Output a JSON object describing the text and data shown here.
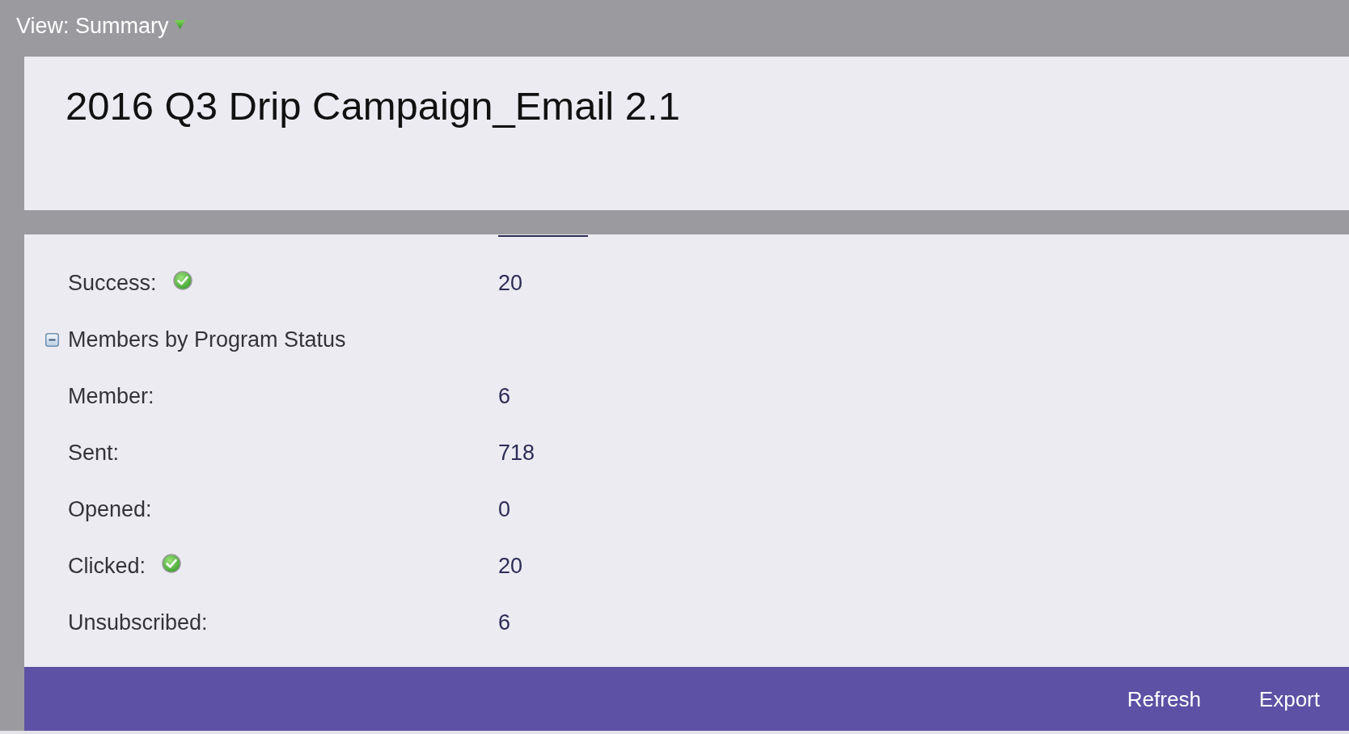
{
  "view_selector": {
    "label": "View: Summary"
  },
  "title": "2016 Q3 Drip Campaign_Email 2.1",
  "rows": [
    {
      "kind": "stat",
      "label": "Success:",
      "value": "20",
      "checked": true
    },
    {
      "kind": "group",
      "label": "Members by Program Status",
      "expanded": true
    },
    {
      "kind": "stat",
      "label": "Member:",
      "value": "6",
      "checked": false
    },
    {
      "kind": "stat",
      "label": "Sent:",
      "value": "718",
      "checked": false
    },
    {
      "kind": "stat",
      "label": "Opened:",
      "value": "0",
      "checked": false
    },
    {
      "kind": "stat",
      "label": "Clicked:",
      "value": "20",
      "checked": true
    },
    {
      "kind": "stat",
      "label": "Unsubscribed:",
      "value": "6",
      "checked": false
    }
  ],
  "footer": {
    "buttons": [
      "Refresh",
      "Export"
    ]
  }
}
